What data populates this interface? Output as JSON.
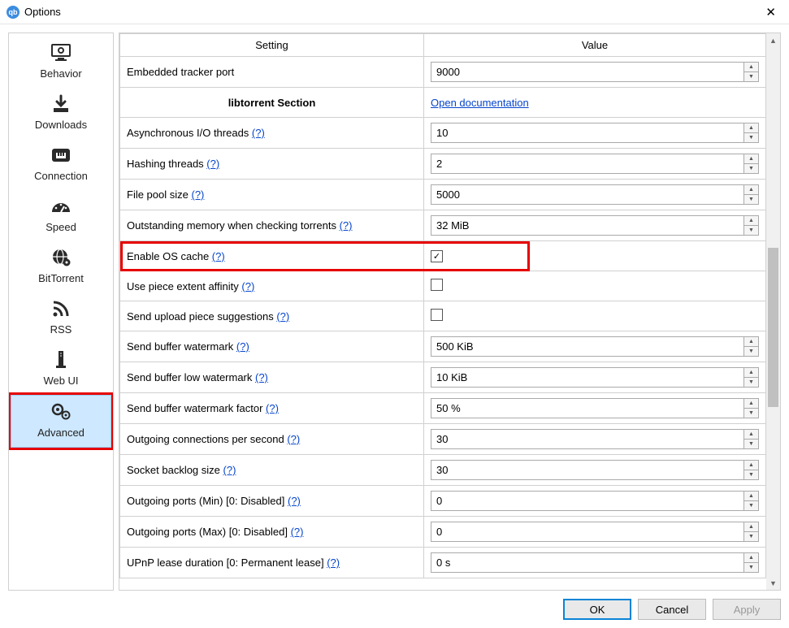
{
  "window": {
    "title": "Options"
  },
  "sidebar": {
    "items": [
      {
        "name": "behavior",
        "label": "Behavior"
      },
      {
        "name": "downloads",
        "label": "Downloads"
      },
      {
        "name": "connection",
        "label": "Connection"
      },
      {
        "name": "speed",
        "label": "Speed"
      },
      {
        "name": "bittorrent",
        "label": "BitTorrent"
      },
      {
        "name": "rss",
        "label": "RSS"
      },
      {
        "name": "webui",
        "label": "Web UI"
      },
      {
        "name": "advanced",
        "label": "Advanced",
        "selected": true,
        "highlighted": true
      }
    ]
  },
  "table": {
    "headers": {
      "setting": "Setting",
      "value": "Value"
    },
    "section": {
      "label": "libtorrent Section",
      "link": "Open documentation"
    },
    "rows": [
      {
        "setting": "Embedded tracker port",
        "value": "9000",
        "type": "spin"
      },
      {
        "section": true
      },
      {
        "setting": "Asynchronous I/O threads",
        "help": true,
        "value": "10",
        "type": "spin"
      },
      {
        "setting": "Hashing threads",
        "help": true,
        "value": "2",
        "type": "spin"
      },
      {
        "setting": "File pool size",
        "help": true,
        "value": "5000",
        "type": "spin"
      },
      {
        "setting": "Outstanding memory when checking torrents",
        "help": true,
        "value": "32 MiB",
        "type": "spin"
      },
      {
        "setting": "Enable OS cache",
        "help": true,
        "value": "checked",
        "type": "check",
        "highlighted": true
      },
      {
        "setting": "Use piece extent affinity",
        "help": true,
        "value": "unchecked",
        "type": "check"
      },
      {
        "setting": "Send upload piece suggestions",
        "help": true,
        "value": "unchecked",
        "type": "check"
      },
      {
        "setting": "Send buffer watermark",
        "help": true,
        "value": "500 KiB",
        "type": "spin"
      },
      {
        "setting": "Send buffer low watermark",
        "help": true,
        "value": "10 KiB",
        "type": "spin"
      },
      {
        "setting": "Send buffer watermark factor",
        "help": true,
        "value": "50 %",
        "type": "spin"
      },
      {
        "setting": "Outgoing connections per second",
        "help": true,
        "value": "30",
        "type": "spin"
      },
      {
        "setting": "Socket backlog size",
        "help": true,
        "value": "30",
        "type": "spin"
      },
      {
        "setting": "Outgoing ports (Min) [0: Disabled]",
        "help": true,
        "value": "0",
        "type": "spin"
      },
      {
        "setting": "Outgoing ports (Max) [0: Disabled]",
        "help": true,
        "value": "0",
        "type": "spin"
      },
      {
        "setting": "UPnP lease duration [0: Permanent lease]",
        "help": true,
        "value": "0 s",
        "type": "spin"
      }
    ],
    "help_text": "(?)"
  },
  "buttons": {
    "ok": "OK",
    "cancel": "Cancel",
    "apply": "Apply"
  }
}
